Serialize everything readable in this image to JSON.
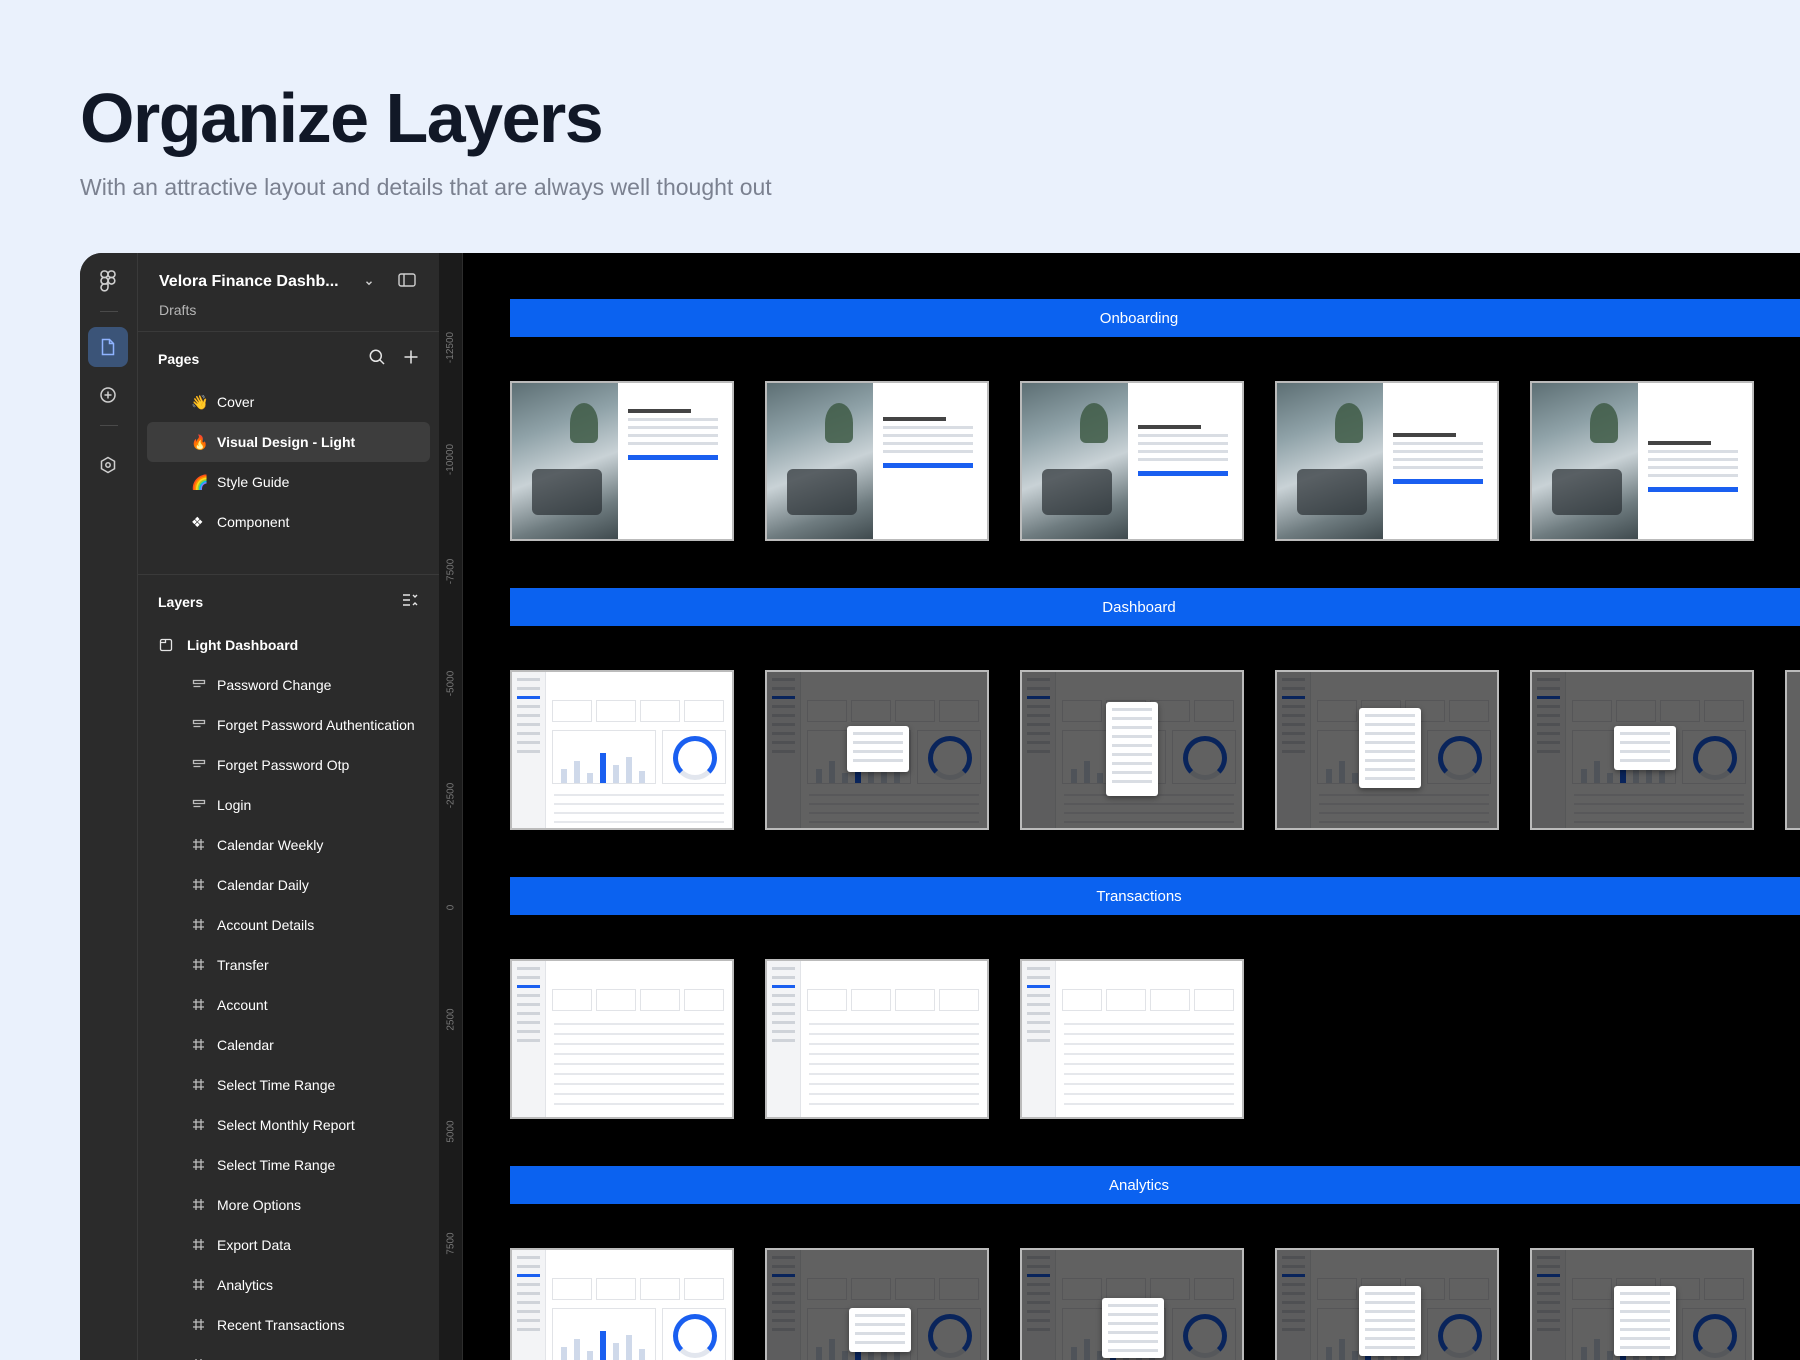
{
  "hero": {
    "title": "Organize Layers",
    "subtitle": "With an attractive layout and details that are always well thought out"
  },
  "file": {
    "title": "Velora Finance Dashb...",
    "location": "Drafts"
  },
  "pages": {
    "heading": "Pages",
    "items": [
      {
        "emoji": "👋",
        "label": "Cover"
      },
      {
        "emoji": "🔥",
        "label": "Visual Design - Light"
      },
      {
        "emoji": "🌈",
        "label": "Style Guide"
      },
      {
        "emoji": "❖",
        "label": "Component"
      }
    ]
  },
  "layers": {
    "heading": "Layers",
    "root": "Light Dashboard",
    "items": [
      {
        "label": "Password Change",
        "icon": "section-icon"
      },
      {
        "label": "Forget Password Authentication",
        "icon": "section-icon"
      },
      {
        "label": "Forget Password Otp",
        "icon": "section-icon"
      },
      {
        "label": "Login",
        "icon": "section-icon"
      },
      {
        "label": "Calendar Weekly",
        "icon": "frame-icon"
      },
      {
        "label": "Calendar Daily",
        "icon": "frame-icon"
      },
      {
        "label": "Account Details",
        "icon": "frame-icon"
      },
      {
        "label": "Transfer",
        "icon": "frame-icon"
      },
      {
        "label": "Account",
        "icon": "frame-icon"
      },
      {
        "label": "Calendar",
        "icon": "frame-icon"
      },
      {
        "label": "Select Time Range",
        "icon": "frame-icon"
      },
      {
        "label": "Select Monthly Report",
        "icon": "frame-icon"
      },
      {
        "label": "Select Time Range",
        "icon": "frame-icon"
      },
      {
        "label": "More Options",
        "icon": "frame-icon"
      },
      {
        "label": "Export Data",
        "icon": "frame-icon"
      },
      {
        "label": "Analytics",
        "icon": "frame-icon"
      },
      {
        "label": "Recent Transactions",
        "icon": "frame-icon"
      },
      {
        "label": "Recent Transactions",
        "icon": "frame-icon"
      }
    ]
  },
  "ruler": [
    "-12500",
    "-10000",
    "-7500",
    "-5000",
    "-2500",
    "0",
    "2500",
    "5000",
    "7500"
  ],
  "sections": [
    {
      "label": "Onboarding"
    },
    {
      "label": "Dashboard"
    },
    {
      "label": "Transactions"
    },
    {
      "label": "Analytics"
    }
  ],
  "colors": {
    "accent": "#0b62f0",
    "panel": "#2b2b2b",
    "canvas": "#000000",
    "page_bg": "#eaf1fc"
  }
}
